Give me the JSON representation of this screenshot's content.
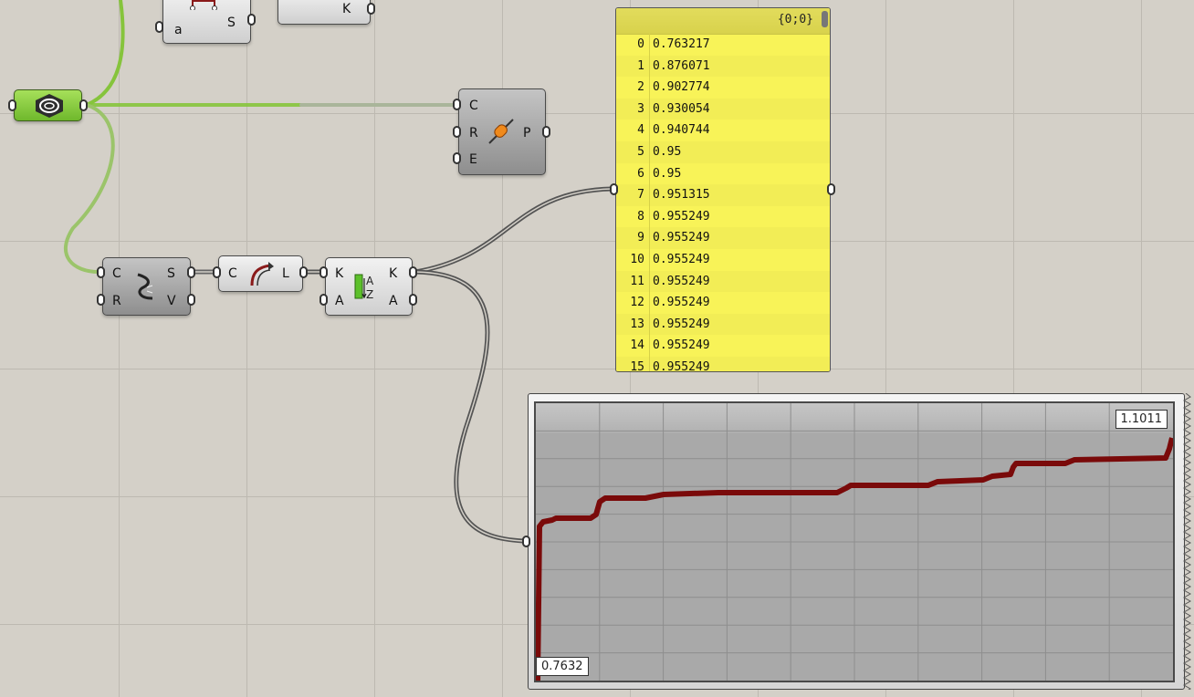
{
  "components": {
    "top_left": {
      "inputs": [
        "a"
      ],
      "outputs": [
        "S"
      ]
    },
    "top_mid": {
      "outputs": [
        "K"
      ]
    },
    "pipe": {
      "inputs": [
        "C",
        "R",
        "E"
      ],
      "outputs": [
        "P"
      ]
    },
    "divide_curve": {
      "inputs": [
        "C",
        "R"
      ],
      "outputs": [
        "S",
        "V"
      ]
    },
    "curve_length": {
      "inputs": [
        "C"
      ],
      "outputs": [
        "L"
      ]
    },
    "sort_list": {
      "inputs": [
        "K",
        "A"
      ],
      "outputs": [
        "K",
        "A"
      ]
    }
  },
  "panel": {
    "path": "{0;0}",
    "rows": [
      {
        "index": "0",
        "value": "0.763217"
      },
      {
        "index": "1",
        "value": "0.876071"
      },
      {
        "index": "2",
        "value": "0.902774"
      },
      {
        "index": "3",
        "value": "0.930054"
      },
      {
        "index": "4",
        "value": "0.940744"
      },
      {
        "index": "5",
        "value": "0.95"
      },
      {
        "index": "6",
        "value": "0.95"
      },
      {
        "index": "7",
        "value": "0.951315"
      },
      {
        "index": "8",
        "value": "0.955249"
      },
      {
        "index": "9",
        "value": "0.955249"
      },
      {
        "index": "10",
        "value": "0.955249"
      },
      {
        "index": "11",
        "value": "0.955249"
      },
      {
        "index": "12",
        "value": "0.955249"
      },
      {
        "index": "13",
        "value": "0.955249"
      },
      {
        "index": "14",
        "value": "0.955249"
      },
      {
        "index": "15",
        "value": "0.955249"
      }
    ]
  },
  "graph": {
    "max_label": "1.1011",
    "min_label": "0.7632",
    "line_color": "#7a0a0a"
  },
  "icons": {
    "geometry_param": "geometry-param-icon",
    "pipe": "pipe-icon",
    "divide": "divide-curve-icon",
    "length": "curve-length-icon",
    "sort": "sort-list-icon"
  }
}
